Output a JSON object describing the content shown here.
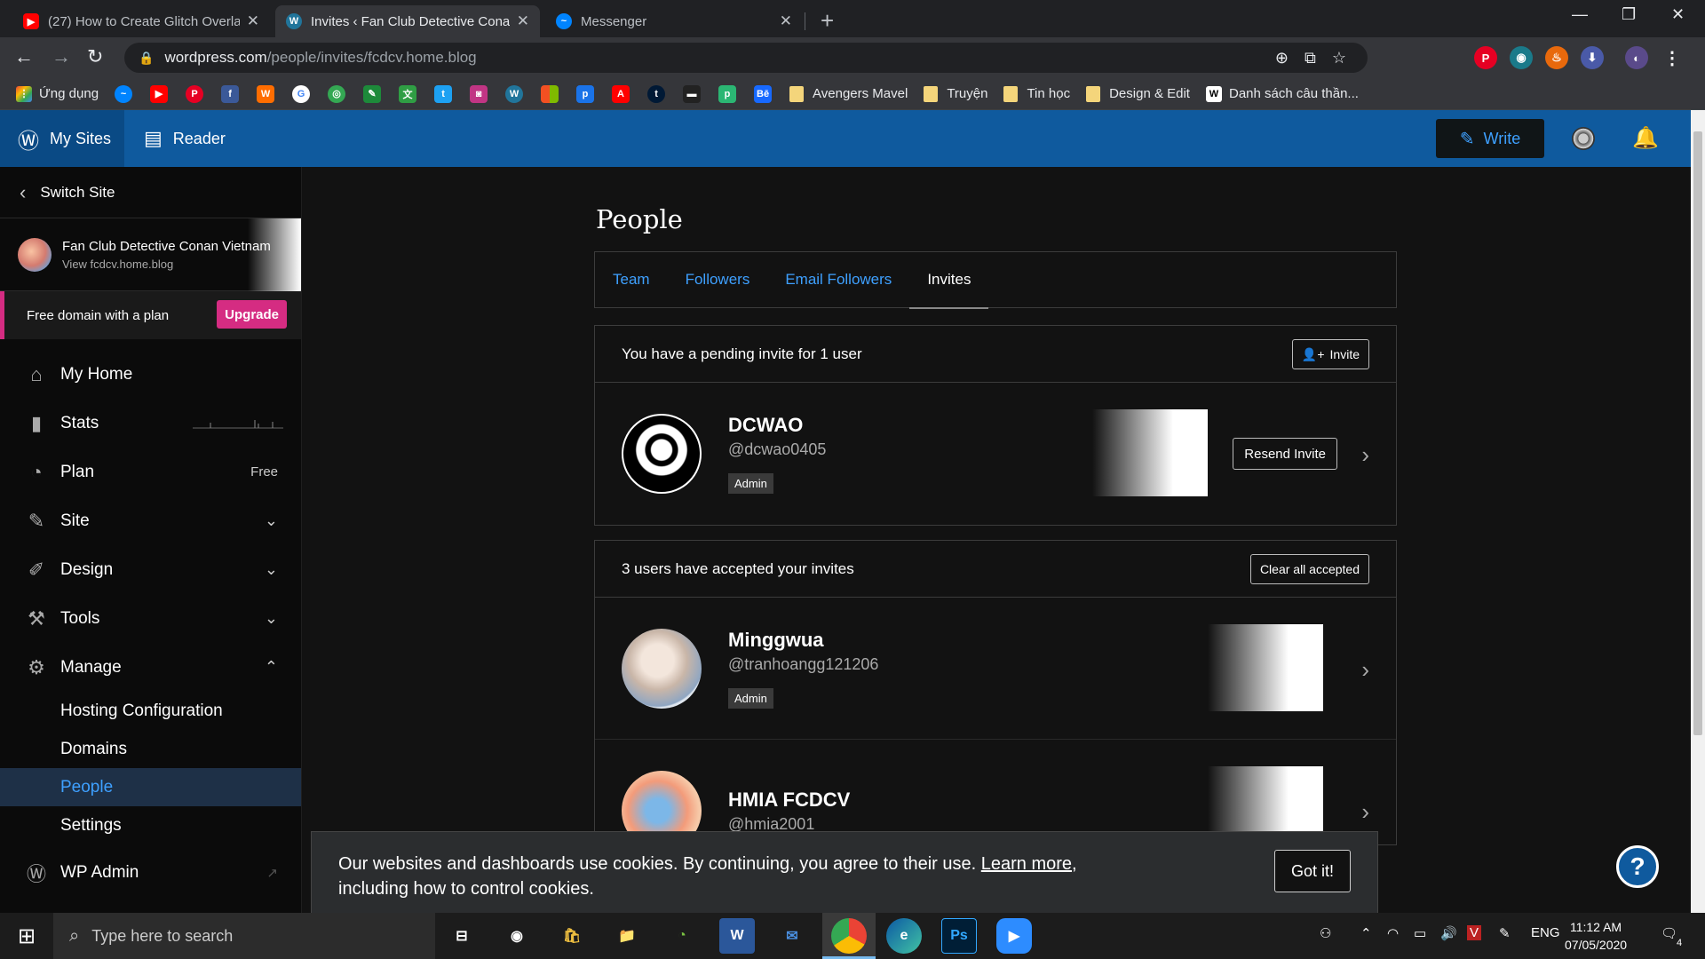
{
  "browser": {
    "tabs": [
      {
        "title": "(27) How to Create Glitch Overla",
        "favicon": "youtube-icon",
        "color": "#ff0000"
      },
      {
        "title": "Invites ‹ Fan Club Detective Cona",
        "favicon": "wordpress-icon",
        "color": "#21759b"
      },
      {
        "title": "Messenger",
        "favicon": "messenger-icon",
        "color": "#0084ff"
      }
    ],
    "url_host": "wordpress.com",
    "url_path": "/people/invites/fcdcv.home.blog"
  },
  "bookmarks": {
    "apps_label": "Ứng dụng",
    "folders": [
      "Avengers Mavel",
      "Truyện",
      "Tin học",
      "Design & Edit"
    ],
    "last_item": "Danh sách câu thần..."
  },
  "masterbar": {
    "my_sites": "My Sites",
    "reader": "Reader",
    "write": "Write"
  },
  "sidebar": {
    "switch_site": "Switch Site",
    "site_name": "Fan Club Detective Conan Vietnam",
    "site_url": "View fcdcv.home.blog",
    "plan_banner": "Free domain with a plan",
    "upgrade": "Upgrade",
    "items": [
      {
        "label": "My Home",
        "icon": "home-icon"
      },
      {
        "label": "Stats",
        "icon": "stats-icon"
      },
      {
        "label": "Plan",
        "icon": "plan-icon",
        "right": "Free"
      },
      {
        "label": "Site",
        "icon": "pencil-icon"
      },
      {
        "label": "Design",
        "icon": "design-icon"
      },
      {
        "label": "Tools",
        "icon": "tools-icon"
      },
      {
        "label": "Manage",
        "icon": "gear-icon"
      }
    ],
    "manage_sub": [
      "Hosting Configuration",
      "Domains",
      "People",
      "Settings"
    ],
    "wp_admin": "WP Admin"
  },
  "people": {
    "title": "People",
    "tabs": [
      "Team",
      "Followers",
      "Email Followers",
      "Invites"
    ],
    "pending": {
      "header": "You have a pending invite for 1 user",
      "invite_button": "Invite",
      "users": [
        {
          "name": "DCWAO",
          "handle": "@dcwao0405",
          "role": "Admin",
          "action": "Resend Invite"
        }
      ]
    },
    "accepted": {
      "header": "3 users have accepted your invites",
      "clear_button": "Clear all accepted",
      "users": [
        {
          "name": "Minggwua",
          "handle": "@tranhoangg121206",
          "role": "Admin"
        },
        {
          "name": "HMIA FCDCV",
          "handle": "@hmia2001"
        }
      ]
    }
  },
  "cookie": {
    "text": "Our websites and dashboards use cookies. By continuing, you agree to their use.",
    "learn_more": "Learn more",
    "text_after": ",",
    "text_line2": "including how to control cookies.",
    "got_it": "Got it!"
  },
  "taskbar": {
    "search_placeholder": "Type here to search",
    "lang": "ENG",
    "time": "11:12 AM",
    "date": "07/05/2020",
    "notifications": "4"
  }
}
